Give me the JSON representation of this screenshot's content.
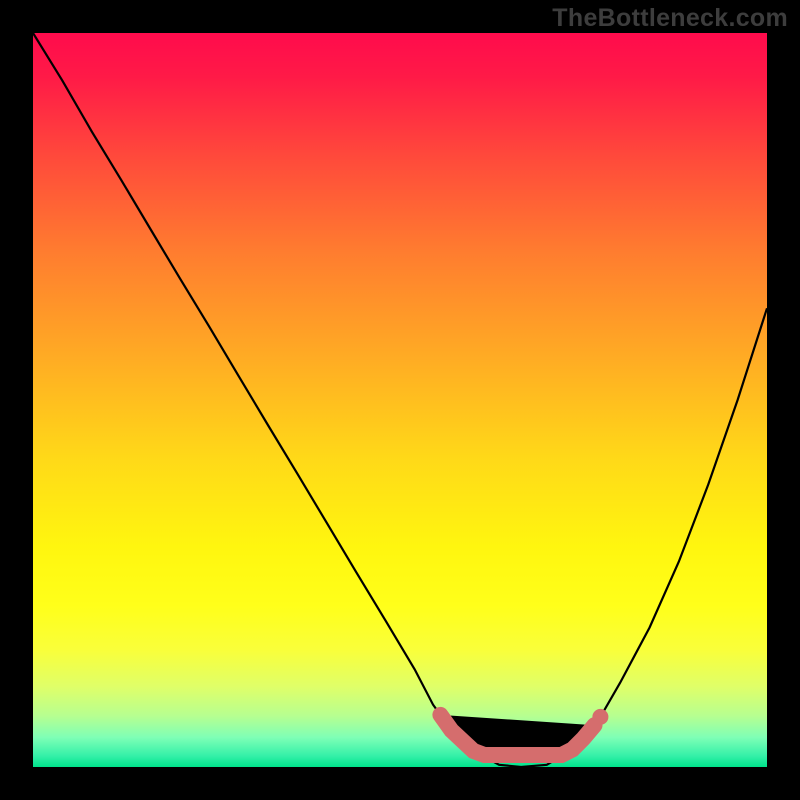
{
  "watermark": "TheBottleneck.com",
  "colors": {
    "curve_stroke": "#000000",
    "band_stroke": "#d56d6d",
    "band_fill": "#d56d6d"
  },
  "chart_data": {
    "type": "line",
    "title": "",
    "xlabel": "",
    "ylabel": "",
    "xlim": [
      0,
      1
    ],
    "ylim": [
      0,
      1
    ],
    "series": [
      {
        "name": "curve",
        "x": [
          0.0,
          0.04,
          0.08,
          0.12,
          0.16,
          0.2,
          0.24,
          0.28,
          0.32,
          0.36,
          0.4,
          0.44,
          0.48,
          0.52,
          0.545,
          0.57,
          0.6,
          0.635,
          0.665,
          0.7,
          0.74,
          0.77,
          0.8,
          0.84,
          0.88,
          0.92,
          0.96,
          1.0
        ],
        "y": [
          1.0,
          0.935,
          0.866,
          0.8,
          0.733,
          0.666,
          0.6,
          0.533,
          0.466,
          0.4,
          0.333,
          0.266,
          0.2,
          0.133,
          0.085,
          0.05,
          0.022,
          0.003,
          0.0,
          0.003,
          0.027,
          0.063,
          0.115,
          0.19,
          0.28,
          0.385,
          0.5,
          0.625
        ]
      }
    ],
    "optimal_band": {
      "x_start": 0.555,
      "x_end": 0.765
    }
  }
}
